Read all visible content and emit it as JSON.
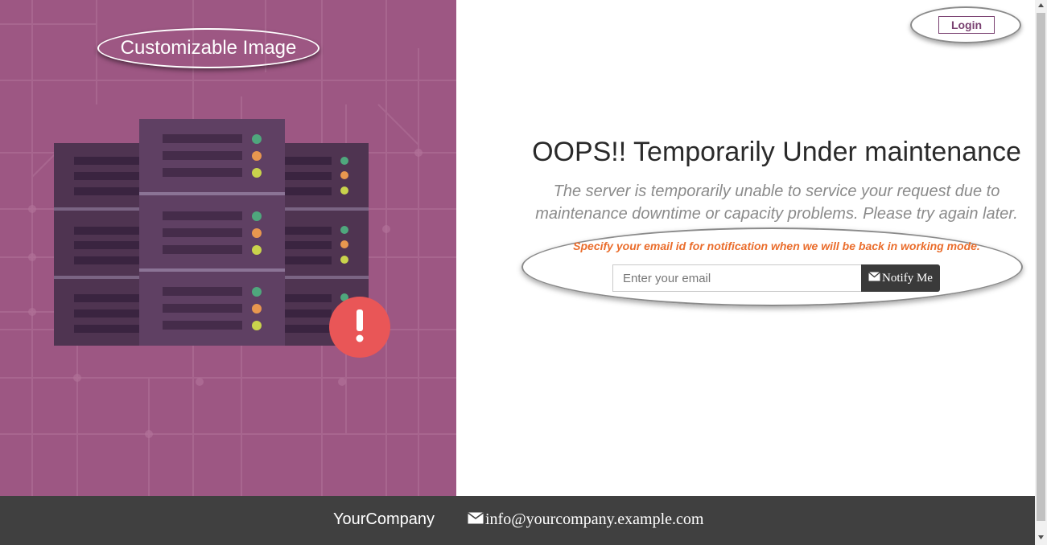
{
  "image_panel": {
    "callout_label": "Customizable Image",
    "background_color": "#9d5783",
    "alert_icon": "exclamation-icon",
    "alert_glyph": "!",
    "art": "server-rack-illustration"
  },
  "header": {
    "login_label": "Login"
  },
  "main": {
    "title": "OOPS!! Temporarily Under maintenance",
    "subtitle": "The server is temporarily unable to service your request due to maintenance downtime or capacity problems. Please try again later.",
    "notify_hint": "Specify your email id for notification when we will be back in working mode.",
    "email_placeholder": "Enter your email",
    "notify_button_label": "Notify Me",
    "notify_button_icon": "envelope-icon"
  },
  "footer": {
    "company": "YourCompany",
    "email": "info@yourcompany.example.com",
    "email_icon": "envelope-icon"
  },
  "colors": {
    "brand": "#7a4171",
    "hint": "#ea6d2c",
    "footer": "#404040",
    "title": "#2a2a2a",
    "subtitle": "#8b8b8b"
  }
}
